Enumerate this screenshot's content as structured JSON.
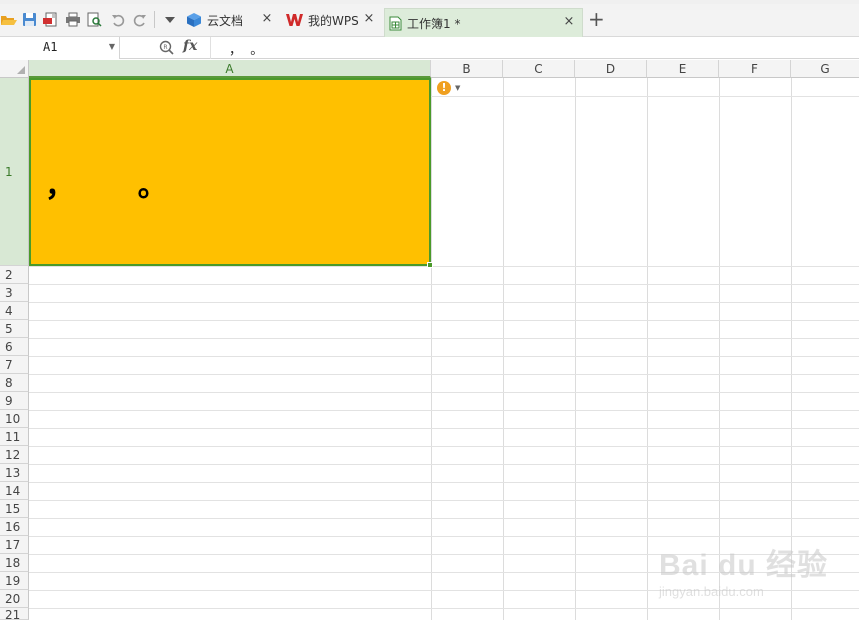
{
  "toolbar": {
    "icons": [
      "open-folder-icon",
      "save-icon",
      "export-pdf-icon",
      "print-icon",
      "print-preview-icon",
      "undo-icon",
      "redo-icon",
      "more-dropdown-icon"
    ]
  },
  "tabs": [
    {
      "label": "云文档",
      "icon": "cloud-cube-icon",
      "active": false
    },
    {
      "label": "我的WPS",
      "icon": "wps-logo-icon",
      "active": false
    },
    {
      "label": "工作簿1 *",
      "icon": "spreadsheet-icon",
      "active": true
    }
  ],
  "tab_close_glyph": "×",
  "new_tab_glyph": "+",
  "formula_bar": {
    "name_box": "A1",
    "fx_label": "fx",
    "content": "，  。"
  },
  "columns": [
    "A",
    "B",
    "C",
    "D",
    "E",
    "F",
    "G"
  ],
  "rows": [
    "1",
    "2",
    "3",
    "4",
    "5",
    "6",
    "7",
    "8",
    "9",
    "10",
    "11",
    "12",
    "13",
    "14",
    "15",
    "16",
    "17",
    "18",
    "19",
    "20",
    "21"
  ],
  "selected_cell": {
    "ref": "A1",
    "value": "，      。",
    "fill_color": "#ffc000",
    "border_color": "#4a9a2a"
  },
  "warning_indicator": "!",
  "watermark": {
    "logo": "Bai du 经验",
    "url": "jingyan.baidu.com"
  }
}
